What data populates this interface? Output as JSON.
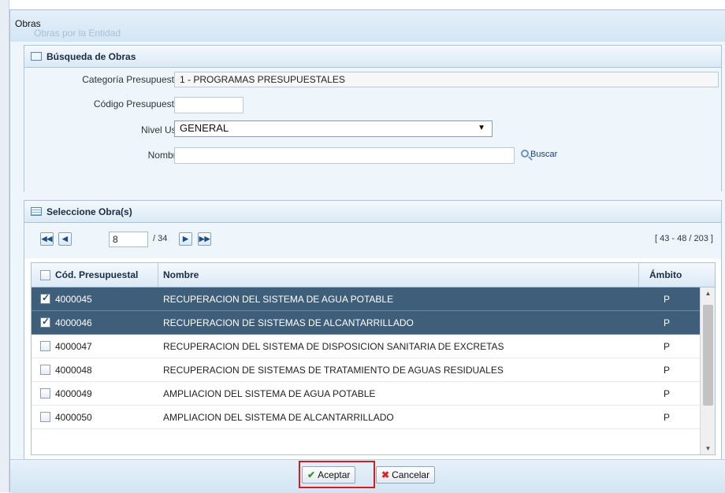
{
  "window": {
    "title": "Obras",
    "ghost_title": "Obras por la Entidad"
  },
  "search_panel": {
    "title": "Búsqueda de Obras",
    "fields": {
      "categoria_label": "Categoría Presupuestal :",
      "categoria_value": "1 - PROGRAMAS PRESUPUESTALES",
      "codigo_label": "Código Presupuestal :",
      "codigo_value": "",
      "nivel_label": "Nivel Uso :",
      "nivel_value": "GENERAL",
      "nombre_label": "Nombre :",
      "nombre_value": ""
    },
    "search_button": "Buscar"
  },
  "results_panel": {
    "title": "Seleccione Obra(s)",
    "pager": {
      "page": "8",
      "total": "/ 34",
      "range": "[ 43 - 48 / 203 ]"
    },
    "columns": {
      "code": "Cód. Presupuestal",
      "name": "Nombre",
      "scope": "Ámbito"
    },
    "rows": [
      {
        "code": "4000045",
        "name": "RECUPERACION DEL SISTEMA DE AGUA POTABLE",
        "scope": "P",
        "checked": true
      },
      {
        "code": "4000046",
        "name": "RECUPERACION DE SISTEMAS DE ALCANTARRILLADO",
        "scope": "P",
        "checked": true
      },
      {
        "code": "4000047",
        "name": "RECUPERACION DEL SISTEMA DE DISPOSICION SANITARIA DE EXCRETAS",
        "scope": "P",
        "checked": false
      },
      {
        "code": "4000048",
        "name": "RECUPERACION DE SISTEMAS DE TRATAMIENTO DE AGUAS RESIDUALES",
        "scope": "P",
        "checked": false
      },
      {
        "code": "4000049",
        "name": "AMPLIACION DEL SISTEMA DE AGUA POTABLE",
        "scope": "P",
        "checked": false
      },
      {
        "code": "4000050",
        "name": "AMPLIACION DEL SISTEMA DE ALCANTARRILLADO",
        "scope": "P",
        "checked": false
      }
    ]
  },
  "footer": {
    "accept": "Aceptar",
    "cancel": "Cancelar"
  },
  "icons": {
    "pager_first": "first-page-icon",
    "pager_prev": "previous-page-icon",
    "pager_next": "next-page-icon",
    "pager_last": "last-page-icon",
    "search": "magnifier-icon",
    "accept": "check-icon",
    "cancel": "red-x-icon"
  },
  "colors": {
    "selected_row": "#3f5e7a",
    "highlight_box": "#d11f1f",
    "accent": "#4f88c4"
  }
}
